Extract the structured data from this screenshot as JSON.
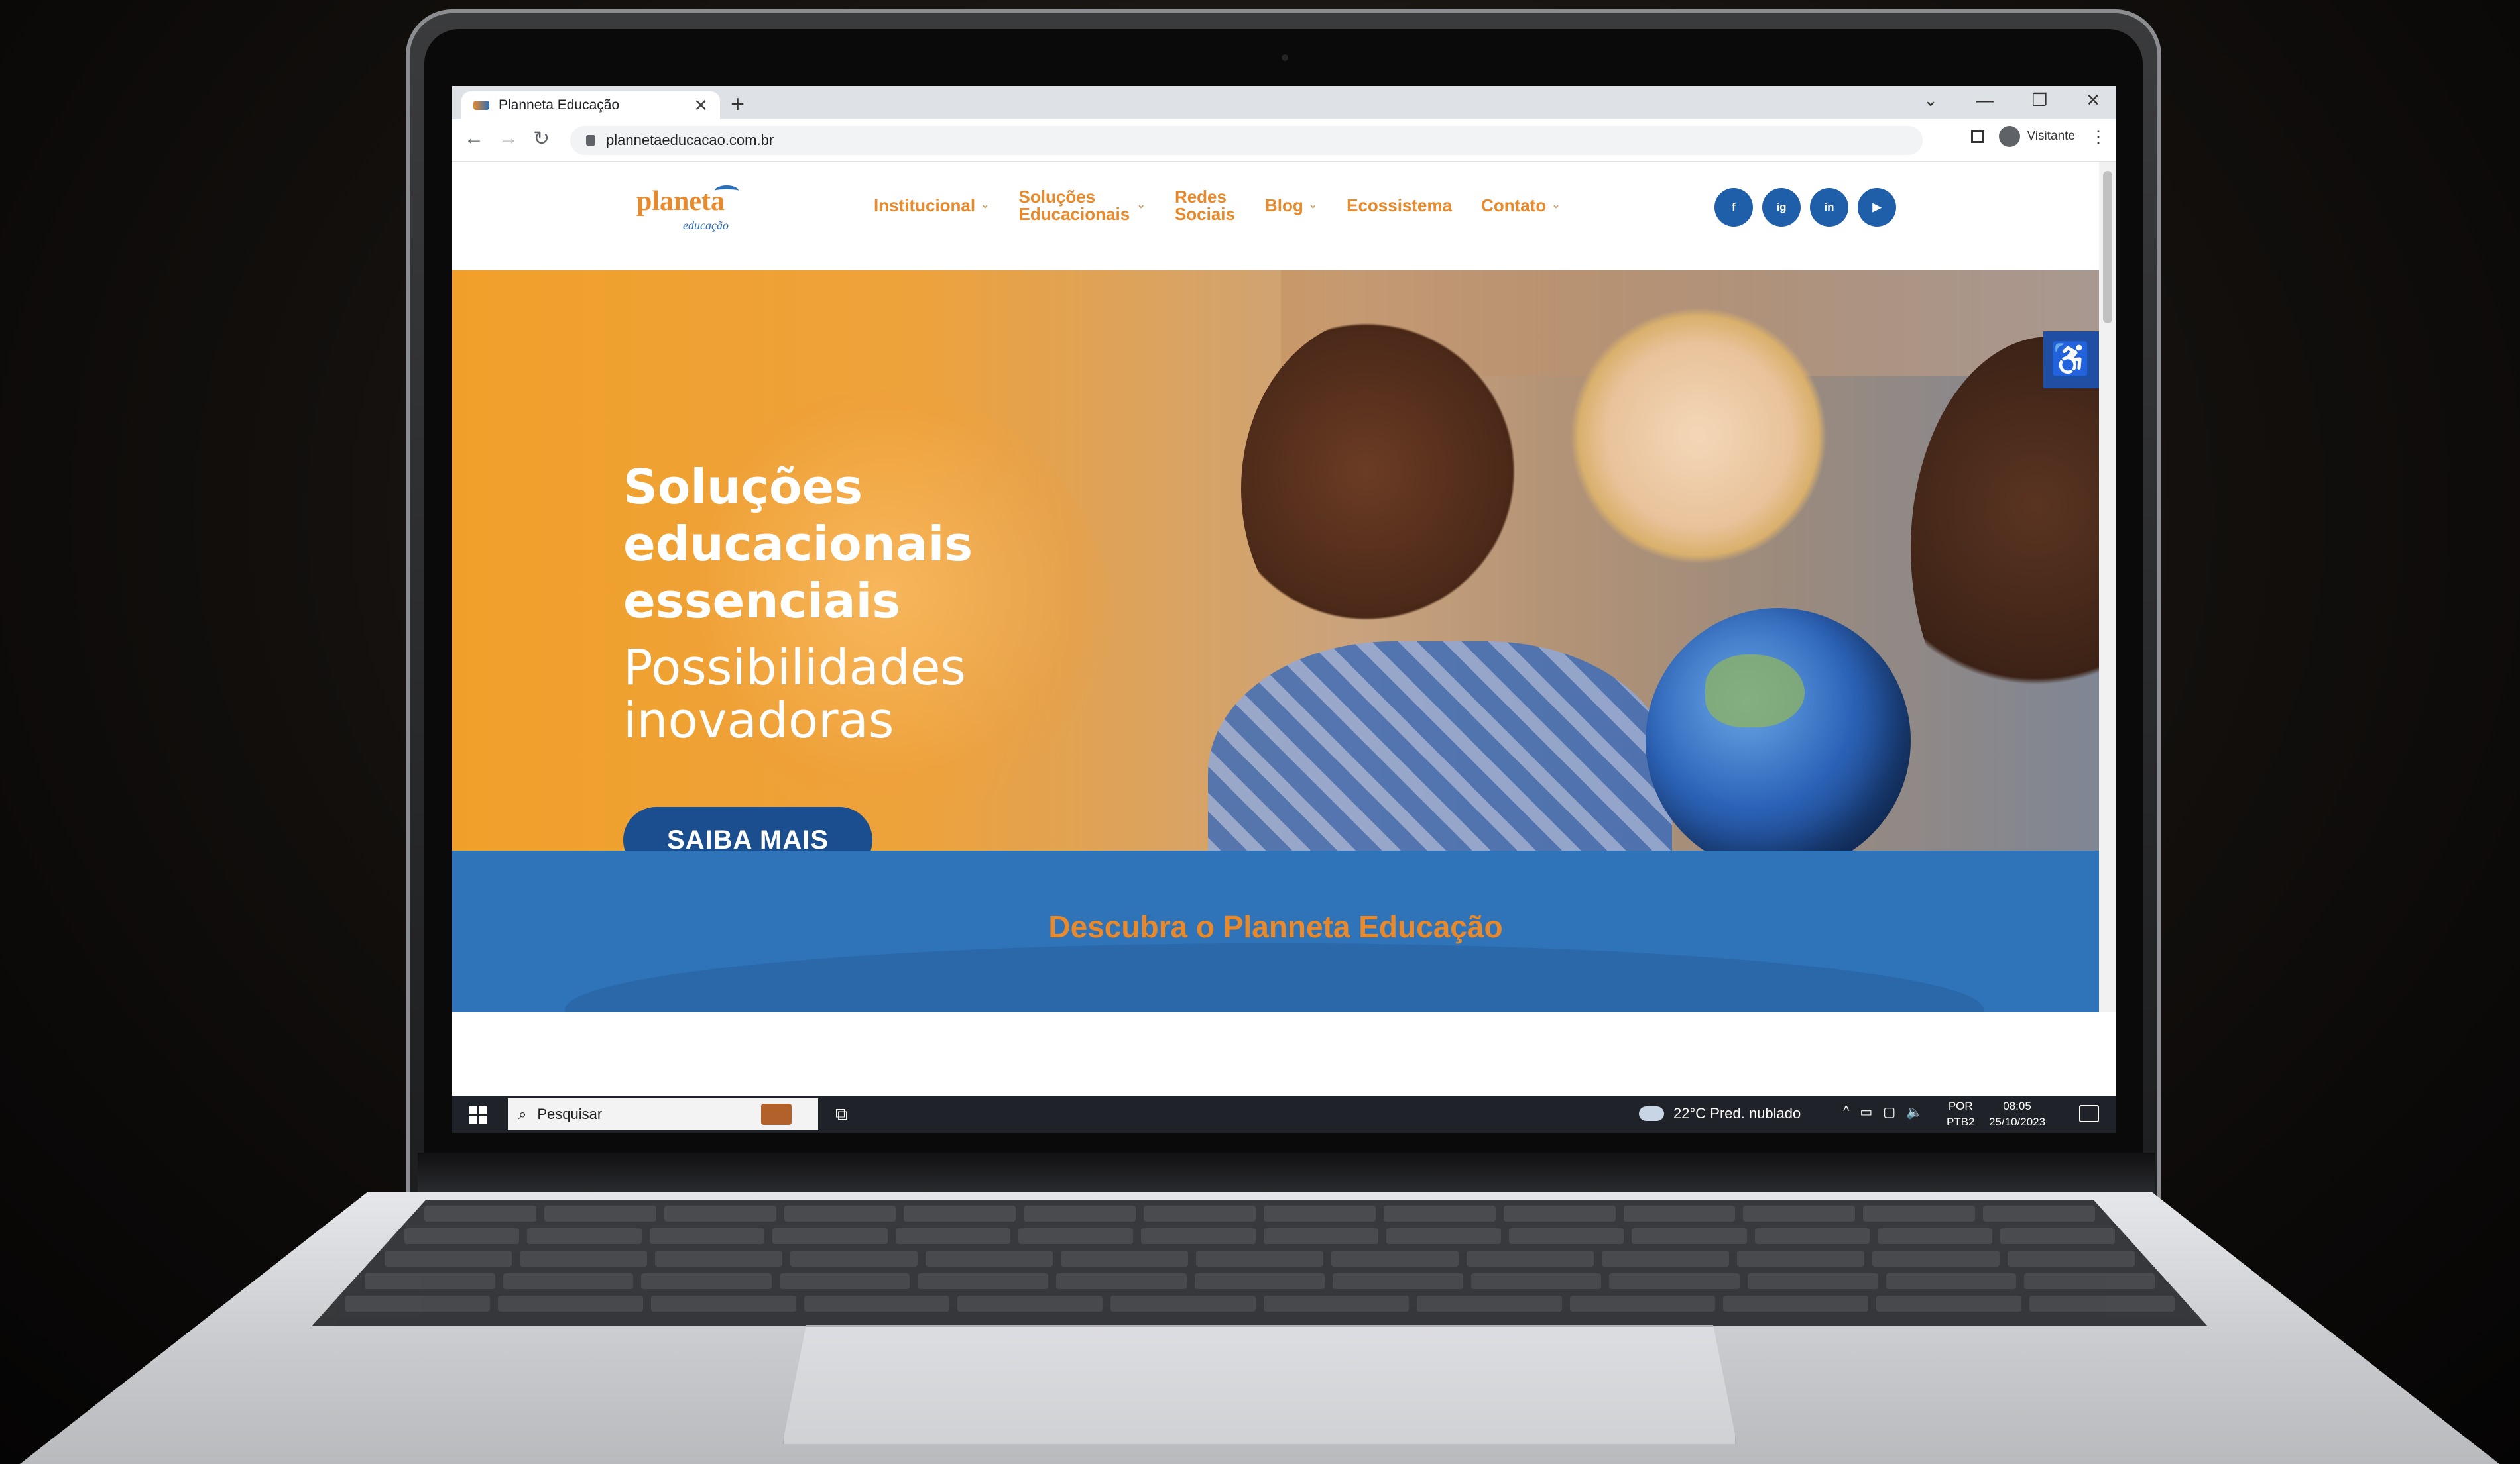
{
  "browser": {
    "tab_title": "Planneta Educação",
    "tab_close": "✕",
    "new_tab": "+",
    "window_controls": [
      "⌄",
      "—",
      "❐",
      "✕"
    ],
    "url": "plannetaeducacao.com.br",
    "profile_label": "Visitante",
    "back": "←",
    "forward": "→",
    "reload": "↻",
    "menu": "⋮"
  },
  "site": {
    "logo_text": "planeta",
    "logo_subtext": "educação",
    "menu": [
      {
        "label": "Institucional",
        "has_dropdown": true
      },
      {
        "label": "Soluções Educacionais",
        "has_dropdown": true
      },
      {
        "label": "Redes Sociais",
        "has_dropdown": false
      },
      {
        "label": "Blog",
        "has_dropdown": true
      },
      {
        "label": "Ecossistema",
        "has_dropdown": false
      },
      {
        "label": "Contato",
        "has_dropdown": true
      }
    ],
    "dropdown_glyph": "⌄",
    "socials": [
      "f",
      "ig",
      "in",
      "▶"
    ],
    "hero": {
      "title": "Soluções educacionais essenciais",
      "subtitle": "Possibilidades inovadoras",
      "cta": "SAIBA MAIS"
    },
    "accessibility_icon": "♿",
    "section_title": "Descubra o Planneta Educação"
  },
  "taskbar": {
    "search_placeholder": "Pesquisar",
    "search_icon": "⌕",
    "taskview_icon": "⧉",
    "weather": "22°C  Pred. nublado",
    "tray_icons": [
      "^",
      "▭",
      "▢",
      "🔈"
    ],
    "lang_line1": "POR",
    "lang_line2": "PTB2",
    "time": "08:05",
    "date": "25/10/2023"
  },
  "colors": {
    "brand_orange": "#e8892b",
    "brand_blue": "#1f5ea9",
    "cta_blue": "#1b4e8f",
    "section_blue": "#2f73b9"
  }
}
